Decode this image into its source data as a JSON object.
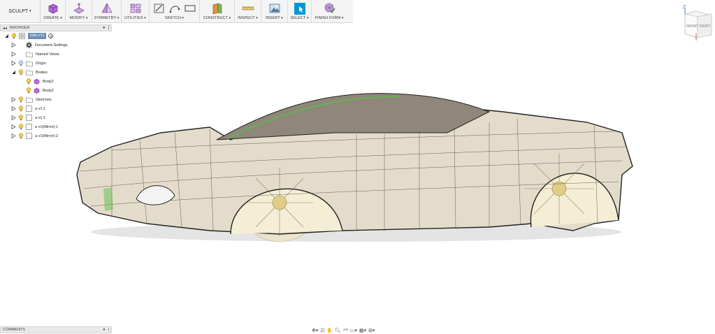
{
  "toolbar": {
    "workspace": "SCULPT",
    "groups": [
      {
        "label": "CREATE"
      },
      {
        "label": "MODIFY"
      },
      {
        "label": "SYMMETRY"
      },
      {
        "label": "UTILITIES"
      },
      {
        "label": "SKETCH"
      },
      {
        "label": "CONSTRUCT"
      },
      {
        "label": "INSPECT"
      },
      {
        "label": "INSERT"
      },
      {
        "label": "SELECT"
      },
      {
        "label": "FINISH FORM"
      }
    ]
  },
  "browser": {
    "title": "BROWSER",
    "root": "lotto v11",
    "items": [
      {
        "label": "Document Settings",
        "icon": "gear-icon"
      },
      {
        "label": "Named Views",
        "icon": "folder-icon"
      },
      {
        "label": "Origin",
        "icon": "folder-icon"
      },
      {
        "label": "Bodies",
        "icon": "folder-icon"
      },
      {
        "label": "Body2",
        "icon": "body-icon"
      },
      {
        "label": "Body3",
        "icon": "body-icon"
      },
      {
        "label": "Sketches",
        "icon": "folder-icon"
      },
      {
        "label": "a v1:1",
        "icon": "component-icon"
      },
      {
        "label": "a v1:1",
        "icon": "component-icon"
      },
      {
        "label": "a v1(Mirror):1",
        "icon": "component-icon"
      },
      {
        "label": "a v1(Mirror):2",
        "icon": "component-icon"
      }
    ]
  },
  "viewcube": {
    "axis": "Z",
    "front": "FRONT",
    "right": "RIGHT"
  },
  "comments": {
    "title": "COMMENTS"
  },
  "colors": {
    "accent": "#0696d7",
    "panel": "#f4f4f4",
    "body_fill": "#d9d2bf",
    "wheel": "#d9c774",
    "edge_highlight": "#5dbb4a"
  }
}
